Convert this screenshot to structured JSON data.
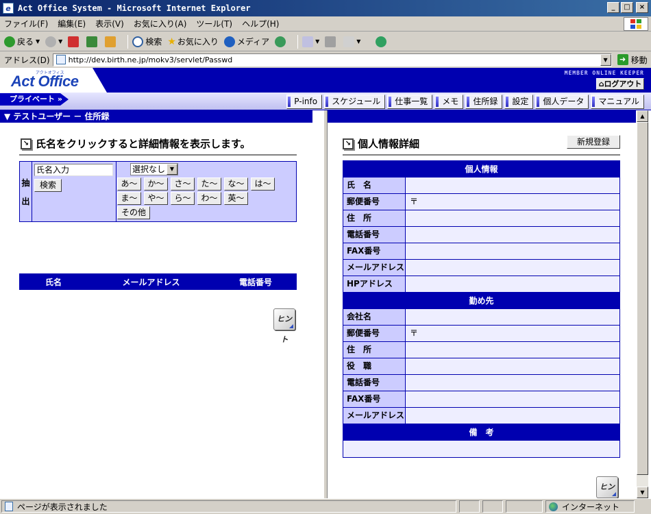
{
  "window": {
    "title": "Act Office System - Microsoft Internet Explorer",
    "controls": [
      "_",
      "□",
      "×"
    ]
  },
  "menu": [
    "ファイル(F)",
    "編集(E)",
    "表示(V)",
    "お気に入り(A)",
    "ツール(T)",
    "ヘルプ(H)"
  ],
  "toolbar": {
    "back": "戻る",
    "search": "検索",
    "favorites": "お気に入り",
    "media": "メディア"
  },
  "address": {
    "label": "アドレス(D)",
    "url": "http://dev.birth.ne.jp/mokv3/servlet/Passwd",
    "go": "移動"
  },
  "header": {
    "logo_small": "アクトオフィス",
    "logo": "Act Office",
    "brand_label": "MEMBER ONLINE KEEPER",
    "logout": "ログアウト",
    "private_tab": "プライベート",
    "nav": [
      "P-info",
      "スケジュール",
      "仕事一覧",
      "メモ",
      "住所録",
      "設定",
      "個人データ",
      "マニュアル"
    ]
  },
  "left": {
    "section_title": "▼ テストユーザー － 住所録",
    "heading": "氏名をクリックすると詳細情報を表示します。",
    "filter_label_1": "抽",
    "filter_label_2": "出",
    "name_input": "氏名入力",
    "search_button": "検索",
    "select_value": "選択なし",
    "kana_row1": [
      "あ～",
      "か～",
      "さ～",
      "た～",
      "な～",
      "は～"
    ],
    "kana_row2": [
      "ま～",
      "や～",
      "ら～",
      "わ～",
      "英～"
    ],
    "other_button": "その他",
    "columns": [
      "氏名",
      "メールアドレス",
      "電話番号"
    ],
    "hint": "ヒント"
  },
  "right": {
    "heading": "個人情報詳細",
    "new_button": "新規登録",
    "personal_section": "個人情報",
    "personal_rows": [
      {
        "label": "氏　名",
        "value": ""
      },
      {
        "label": "郵便番号",
        "value": "〒"
      },
      {
        "label": "住　所",
        "value": ""
      },
      {
        "label": "電話番号",
        "value": ""
      },
      {
        "label": "FAX番号",
        "value": ""
      },
      {
        "label": "メールアドレス",
        "value": ""
      },
      {
        "label": "HPアドレス",
        "value": ""
      }
    ],
    "work_section": "勤め先",
    "work_rows": [
      {
        "label": "会社名",
        "value": ""
      },
      {
        "label": "郵便番号",
        "value": "〒"
      },
      {
        "label": "住　所",
        "value": ""
      },
      {
        "label": "役　職",
        "value": ""
      },
      {
        "label": "電話番号",
        "value": ""
      },
      {
        "label": "FAX番号",
        "value": ""
      },
      {
        "label": "メールアドレス",
        "value": ""
      }
    ],
    "notes_section": "備　考",
    "hint": "ヒント"
  },
  "status": {
    "text": "ページが表示されました",
    "zone": "インターネット"
  },
  "colors": {
    "navy": "#0000b0",
    "label_bg": "#ccccff",
    "value_bg": "#eeeeff"
  }
}
